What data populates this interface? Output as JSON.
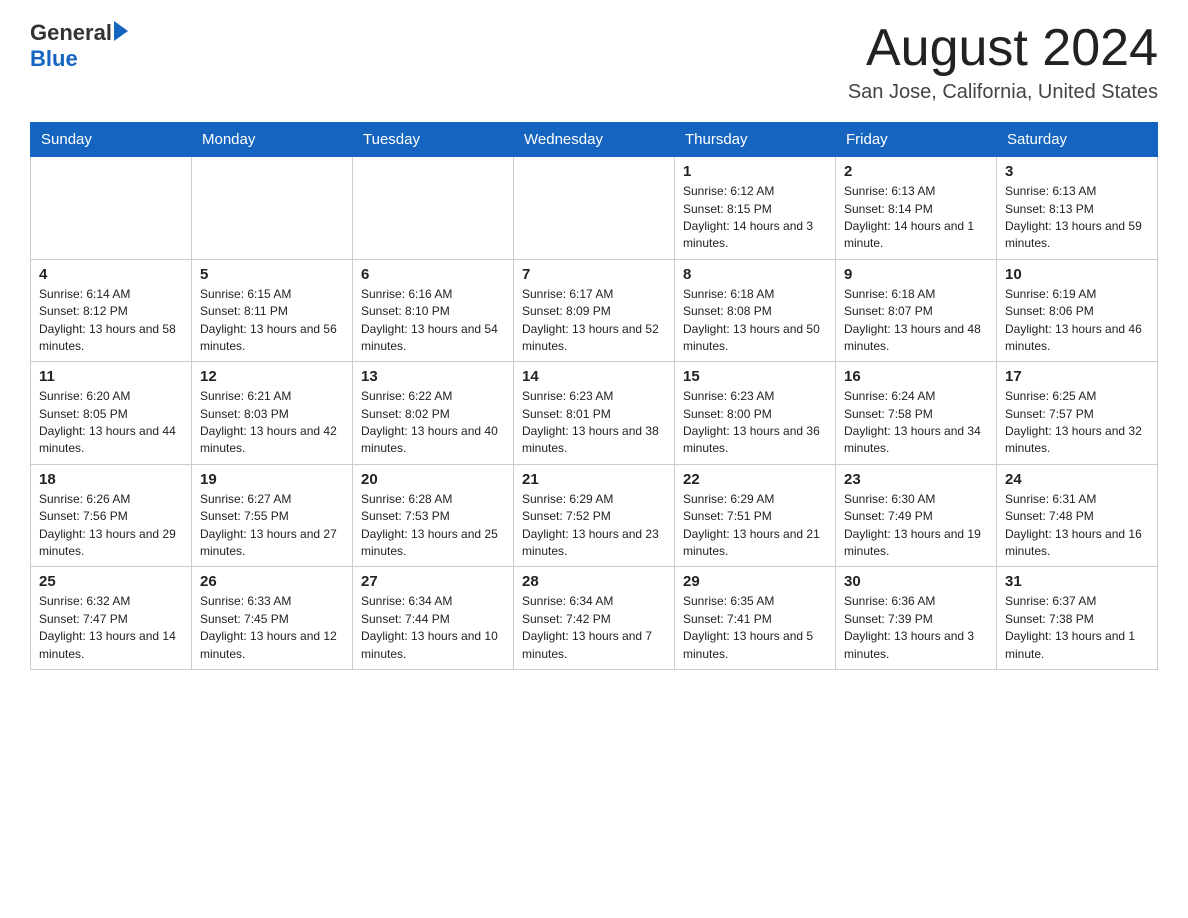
{
  "header": {
    "logo_general": "General",
    "logo_blue": "Blue",
    "month_title": "August 2024",
    "location": "San Jose, California, United States"
  },
  "days_of_week": [
    "Sunday",
    "Monday",
    "Tuesday",
    "Wednesday",
    "Thursday",
    "Friday",
    "Saturday"
  ],
  "weeks": [
    [
      {
        "day": "",
        "info": ""
      },
      {
        "day": "",
        "info": ""
      },
      {
        "day": "",
        "info": ""
      },
      {
        "day": "",
        "info": ""
      },
      {
        "day": "1",
        "info": "Sunrise: 6:12 AM\nSunset: 8:15 PM\nDaylight: 14 hours and 3 minutes."
      },
      {
        "day": "2",
        "info": "Sunrise: 6:13 AM\nSunset: 8:14 PM\nDaylight: 14 hours and 1 minute."
      },
      {
        "day": "3",
        "info": "Sunrise: 6:13 AM\nSunset: 8:13 PM\nDaylight: 13 hours and 59 minutes."
      }
    ],
    [
      {
        "day": "4",
        "info": "Sunrise: 6:14 AM\nSunset: 8:12 PM\nDaylight: 13 hours and 58 minutes."
      },
      {
        "day": "5",
        "info": "Sunrise: 6:15 AM\nSunset: 8:11 PM\nDaylight: 13 hours and 56 minutes."
      },
      {
        "day": "6",
        "info": "Sunrise: 6:16 AM\nSunset: 8:10 PM\nDaylight: 13 hours and 54 minutes."
      },
      {
        "day": "7",
        "info": "Sunrise: 6:17 AM\nSunset: 8:09 PM\nDaylight: 13 hours and 52 minutes."
      },
      {
        "day": "8",
        "info": "Sunrise: 6:18 AM\nSunset: 8:08 PM\nDaylight: 13 hours and 50 minutes."
      },
      {
        "day": "9",
        "info": "Sunrise: 6:18 AM\nSunset: 8:07 PM\nDaylight: 13 hours and 48 minutes."
      },
      {
        "day": "10",
        "info": "Sunrise: 6:19 AM\nSunset: 8:06 PM\nDaylight: 13 hours and 46 minutes."
      }
    ],
    [
      {
        "day": "11",
        "info": "Sunrise: 6:20 AM\nSunset: 8:05 PM\nDaylight: 13 hours and 44 minutes."
      },
      {
        "day": "12",
        "info": "Sunrise: 6:21 AM\nSunset: 8:03 PM\nDaylight: 13 hours and 42 minutes."
      },
      {
        "day": "13",
        "info": "Sunrise: 6:22 AM\nSunset: 8:02 PM\nDaylight: 13 hours and 40 minutes."
      },
      {
        "day": "14",
        "info": "Sunrise: 6:23 AM\nSunset: 8:01 PM\nDaylight: 13 hours and 38 minutes."
      },
      {
        "day": "15",
        "info": "Sunrise: 6:23 AM\nSunset: 8:00 PM\nDaylight: 13 hours and 36 minutes."
      },
      {
        "day": "16",
        "info": "Sunrise: 6:24 AM\nSunset: 7:58 PM\nDaylight: 13 hours and 34 minutes."
      },
      {
        "day": "17",
        "info": "Sunrise: 6:25 AM\nSunset: 7:57 PM\nDaylight: 13 hours and 32 minutes."
      }
    ],
    [
      {
        "day": "18",
        "info": "Sunrise: 6:26 AM\nSunset: 7:56 PM\nDaylight: 13 hours and 29 minutes."
      },
      {
        "day": "19",
        "info": "Sunrise: 6:27 AM\nSunset: 7:55 PM\nDaylight: 13 hours and 27 minutes."
      },
      {
        "day": "20",
        "info": "Sunrise: 6:28 AM\nSunset: 7:53 PM\nDaylight: 13 hours and 25 minutes."
      },
      {
        "day": "21",
        "info": "Sunrise: 6:29 AM\nSunset: 7:52 PM\nDaylight: 13 hours and 23 minutes."
      },
      {
        "day": "22",
        "info": "Sunrise: 6:29 AM\nSunset: 7:51 PM\nDaylight: 13 hours and 21 minutes."
      },
      {
        "day": "23",
        "info": "Sunrise: 6:30 AM\nSunset: 7:49 PM\nDaylight: 13 hours and 19 minutes."
      },
      {
        "day": "24",
        "info": "Sunrise: 6:31 AM\nSunset: 7:48 PM\nDaylight: 13 hours and 16 minutes."
      }
    ],
    [
      {
        "day": "25",
        "info": "Sunrise: 6:32 AM\nSunset: 7:47 PM\nDaylight: 13 hours and 14 minutes."
      },
      {
        "day": "26",
        "info": "Sunrise: 6:33 AM\nSunset: 7:45 PM\nDaylight: 13 hours and 12 minutes."
      },
      {
        "day": "27",
        "info": "Sunrise: 6:34 AM\nSunset: 7:44 PM\nDaylight: 13 hours and 10 minutes."
      },
      {
        "day": "28",
        "info": "Sunrise: 6:34 AM\nSunset: 7:42 PM\nDaylight: 13 hours and 7 minutes."
      },
      {
        "day": "29",
        "info": "Sunrise: 6:35 AM\nSunset: 7:41 PM\nDaylight: 13 hours and 5 minutes."
      },
      {
        "day": "30",
        "info": "Sunrise: 6:36 AM\nSunset: 7:39 PM\nDaylight: 13 hours and 3 minutes."
      },
      {
        "day": "31",
        "info": "Sunrise: 6:37 AM\nSunset: 7:38 PM\nDaylight: 13 hours and 1 minute."
      }
    ]
  ]
}
